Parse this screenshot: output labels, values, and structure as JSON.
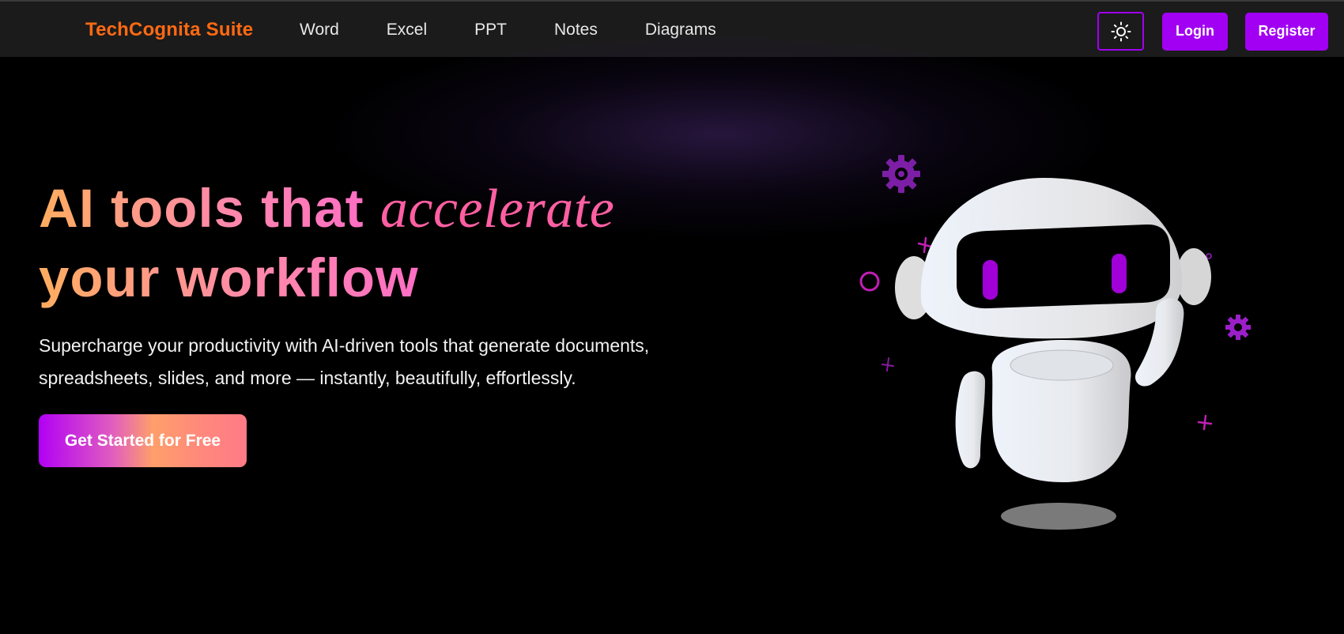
{
  "nav": {
    "brand": "TechCognita Suite",
    "links": [
      "Word",
      "Excel",
      "PPT",
      "Notes",
      "Diagrams"
    ],
    "theme_toggle_icon": "sun-icon",
    "login_label": "Login",
    "register_label": "Register"
  },
  "hero": {
    "headline_part1": "AI tools that",
    "headline_accent": "accelerate",
    "headline_part2": "your workflow",
    "subtitle_line1": "Supercharge your productivity with AI-driven tools that generate documents,",
    "subtitle_line2": "spreadsheets, slides, and more — instantly, beautifully, effortlessly.",
    "cta_label": "Get Started for Free"
  },
  "colors": {
    "brand": "#ff6a13",
    "accent_purple": "#a100f2",
    "accent_pink": "#ff5fa2",
    "navbar_bg": "#1b1b1b",
    "page_bg": "#000000"
  },
  "illustration": {
    "icon": "robot-illustration",
    "decorations": [
      "gear-icon",
      "gear-icon",
      "plus-icon",
      "plus-icon",
      "plus-icon",
      "circle-icon"
    ]
  }
}
